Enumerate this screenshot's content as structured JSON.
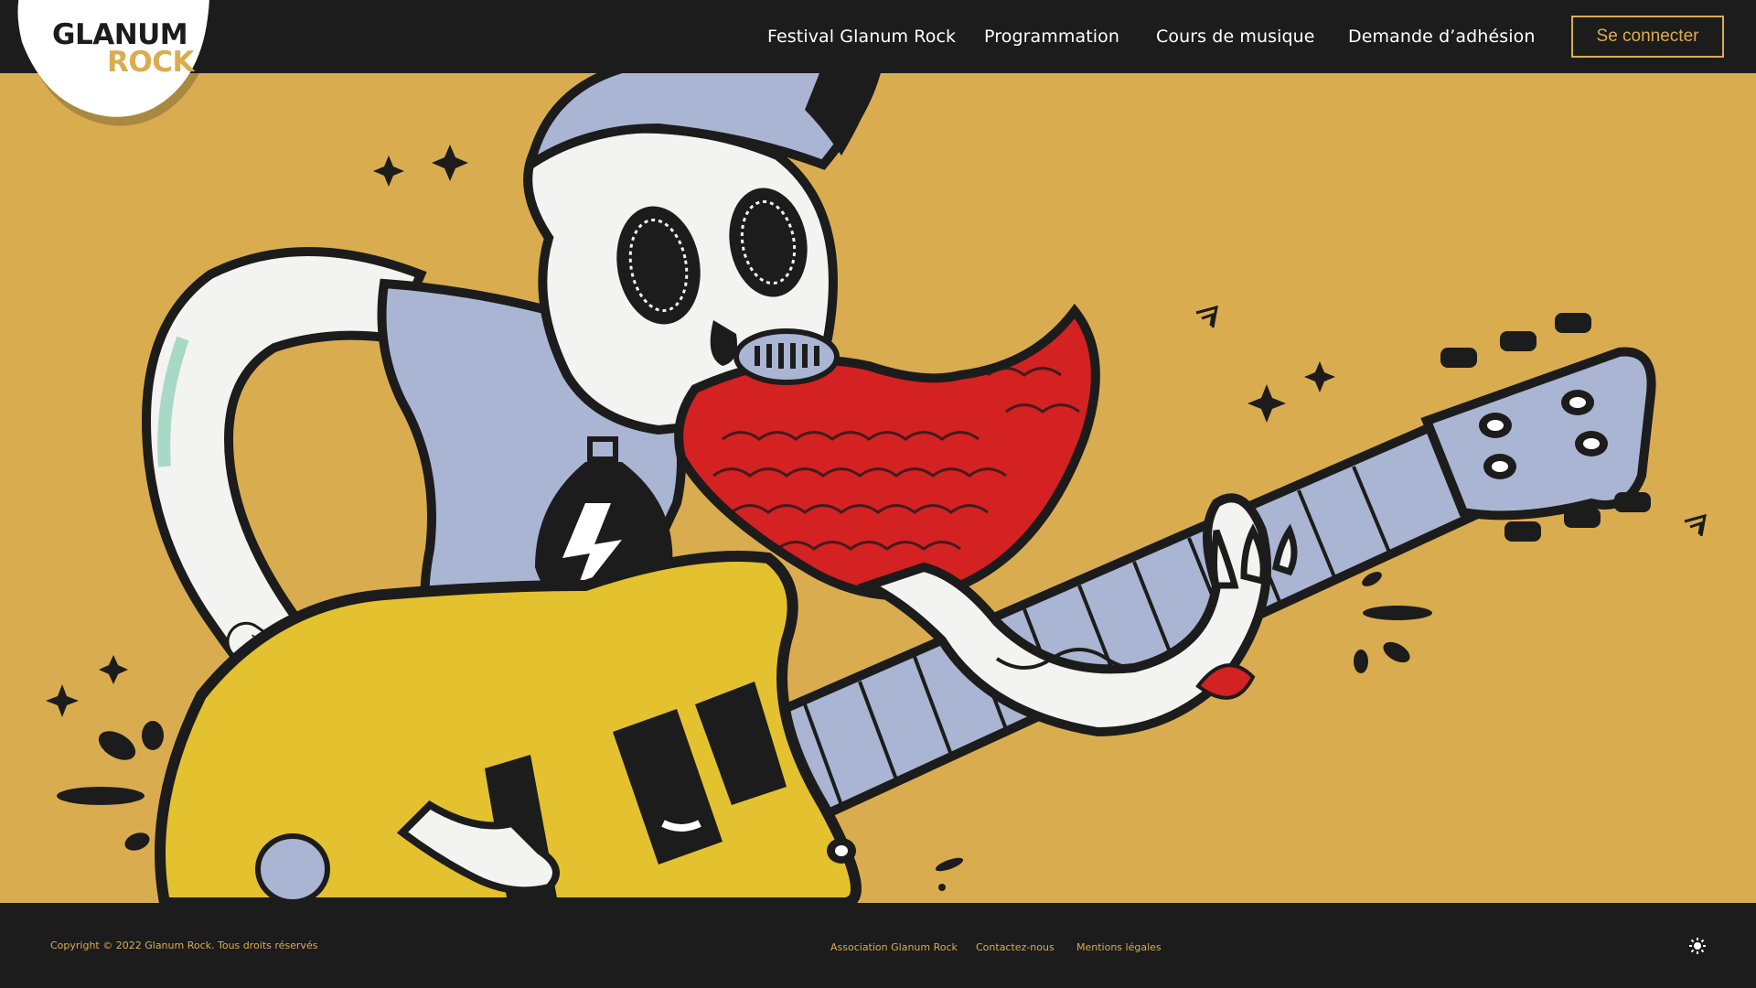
{
  "brand": {
    "line1": "GLANUM",
    "line2": "ROCK",
    "accent": "#d9ad4f",
    "dark": "#1c1c1c"
  },
  "nav": {
    "items": [
      {
        "label": "Festival Glanum Rock"
      },
      {
        "label": "Programmation"
      },
      {
        "label": "Cours de musique"
      },
      {
        "label": "Demande d’adhésion"
      }
    ],
    "login_label": "Se connecter"
  },
  "hero": {
    "illustration": "skeleton-rocker-playing-guitar",
    "background": "#d9ad4f",
    "beard_color": "#d42122",
    "guitar_color": "#e3c12f",
    "shirt_color": "#aab5d3"
  },
  "footer": {
    "copyright": "Copyright © 2022 Glanum Rock. Tous droits réservés",
    "links": [
      {
        "label": "Association Glanum Rock"
      },
      {
        "label": "Contactez-nous"
      },
      {
        "label": "Mentions légales"
      }
    ],
    "theme_icon": "sun-icon"
  }
}
